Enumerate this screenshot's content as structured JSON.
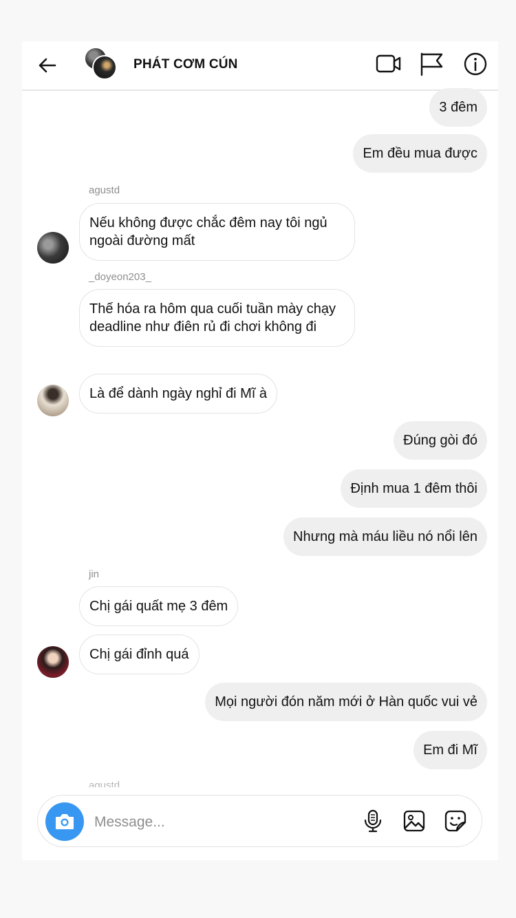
{
  "header": {
    "title": "PHÁT CƠM CÚN",
    "icons": [
      "back-arrow-icon",
      "video-call-icon",
      "flag-icon",
      "info-icon"
    ]
  },
  "messages": [
    {
      "direction": "out",
      "text": "3 đêm"
    },
    {
      "direction": "out",
      "text": "Em đều mua được"
    },
    {
      "direction": "in",
      "sender": "agustd",
      "text": "Nếu không được chắc đêm nay tôi ngủ ngoài đường mất"
    },
    {
      "direction": "in",
      "sender": "_doyeon203_",
      "text": "Thế hóa ra hôm qua cuối tuần mày chạy deadline như điên rủ đi chơi không đi"
    },
    {
      "direction": "in",
      "text": "Là để dành ngày nghỉ đi Mĩ à"
    },
    {
      "direction": "out",
      "text": "Đúng gòi đó"
    },
    {
      "direction": "out",
      "text": "Định mua 1 đêm thôi"
    },
    {
      "direction": "out",
      "text": "Nhưng mà máu liều nó nổi lên"
    },
    {
      "direction": "in",
      "sender": "jin",
      "text": "Chị gái quất mẹ 3 đêm"
    },
    {
      "direction": "in",
      "text": "Chị gái đỉnh quá"
    },
    {
      "direction": "out",
      "text": "Mọi người đón năm mới ở Hàn quốc vui vẻ"
    },
    {
      "direction": "out",
      "text": "Em đi Mĩ"
    }
  ],
  "partial_sender": "agustd",
  "composer": {
    "placeholder": "Message...",
    "icons": [
      "camera-icon",
      "microphone-icon",
      "gallery-icon",
      "sticker-icon"
    ]
  },
  "colors": {
    "outgoing_bubble": "#efefef",
    "incoming_border": "#e3e3e3",
    "camera_button": "#3897f0",
    "sender_text": "#8e8e8e"
  }
}
